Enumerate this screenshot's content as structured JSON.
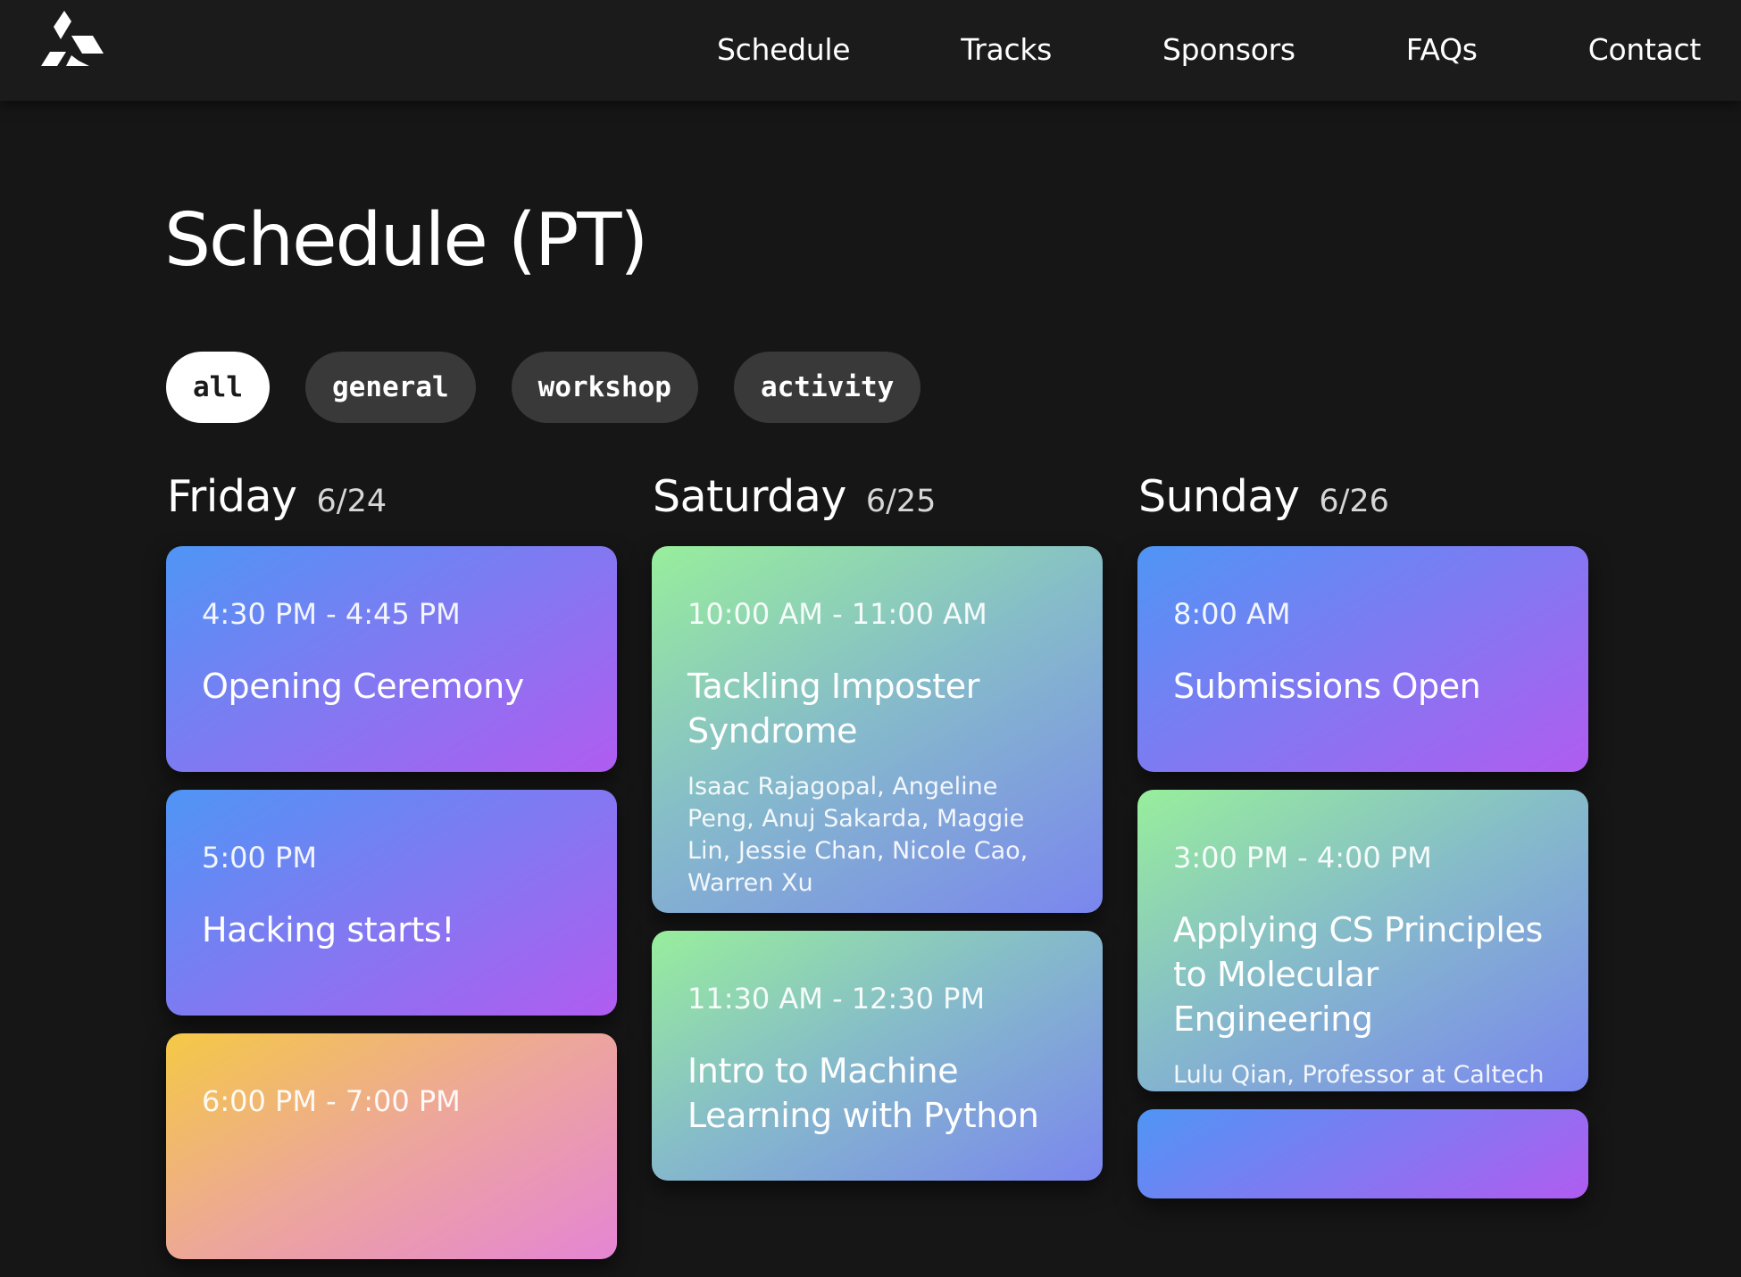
{
  "nav": {
    "links": [
      "Schedule",
      "Tracks",
      "Sponsors",
      "FAQs",
      "Contact"
    ]
  },
  "page": {
    "title": "Schedule (PT)"
  },
  "filters": [
    {
      "label": "all",
      "active": true
    },
    {
      "label": "general",
      "active": false
    },
    {
      "label": "workshop",
      "active": false
    },
    {
      "label": "activity",
      "active": false
    }
  ],
  "colors": {
    "background": "#161616",
    "navbar": "#1b1b1b",
    "pill": "#393939",
    "general_gradient": [
      "#4f95f5",
      "#b05cf0"
    ],
    "workshop_gradient": [
      "#98ee9c",
      "#7a86ef"
    ],
    "activity_gradient": [
      "#f4c945",
      "#e585d4"
    ]
  },
  "days": [
    {
      "name": "Friday",
      "date": "6/24",
      "events": [
        {
          "time": "4:30 PM - 4:45 PM",
          "title": "Opening Ceremony",
          "people": "",
          "category": "general"
        },
        {
          "time": "5:00 PM",
          "title": "Hacking starts!",
          "people": "",
          "category": "general"
        },
        {
          "time": "6:00 PM - 7:00 PM",
          "title": "",
          "people": "",
          "category": "activity"
        }
      ]
    },
    {
      "name": "Saturday",
      "date": "6/25",
      "events": [
        {
          "time": "10:00 AM - 11:00 AM",
          "title": "Tackling Imposter Syndrome",
          "people": "Isaac Rajagopal, Angeline Peng, Anuj Sakarda, Maggie Lin, Jessie Chan, Nicole Cao, Warren Xu",
          "category": "workshop"
        },
        {
          "time": "11:30 AM - 12:30 PM",
          "title": "Intro to Machine Learning with Python",
          "people": "",
          "category": "workshop"
        }
      ]
    },
    {
      "name": "Sunday",
      "date": "6/26",
      "events": [
        {
          "time": "8:00 AM",
          "title": "Submissions Open",
          "people": "",
          "category": "general"
        },
        {
          "time": "3:00 PM - 4:00 PM",
          "title": "Applying CS Principles to Molecular Engineering",
          "people": "Lulu Qian, Professor at Caltech",
          "category": "workshop"
        },
        {
          "time": "",
          "title": "",
          "people": "",
          "category": "general"
        }
      ]
    }
  ]
}
